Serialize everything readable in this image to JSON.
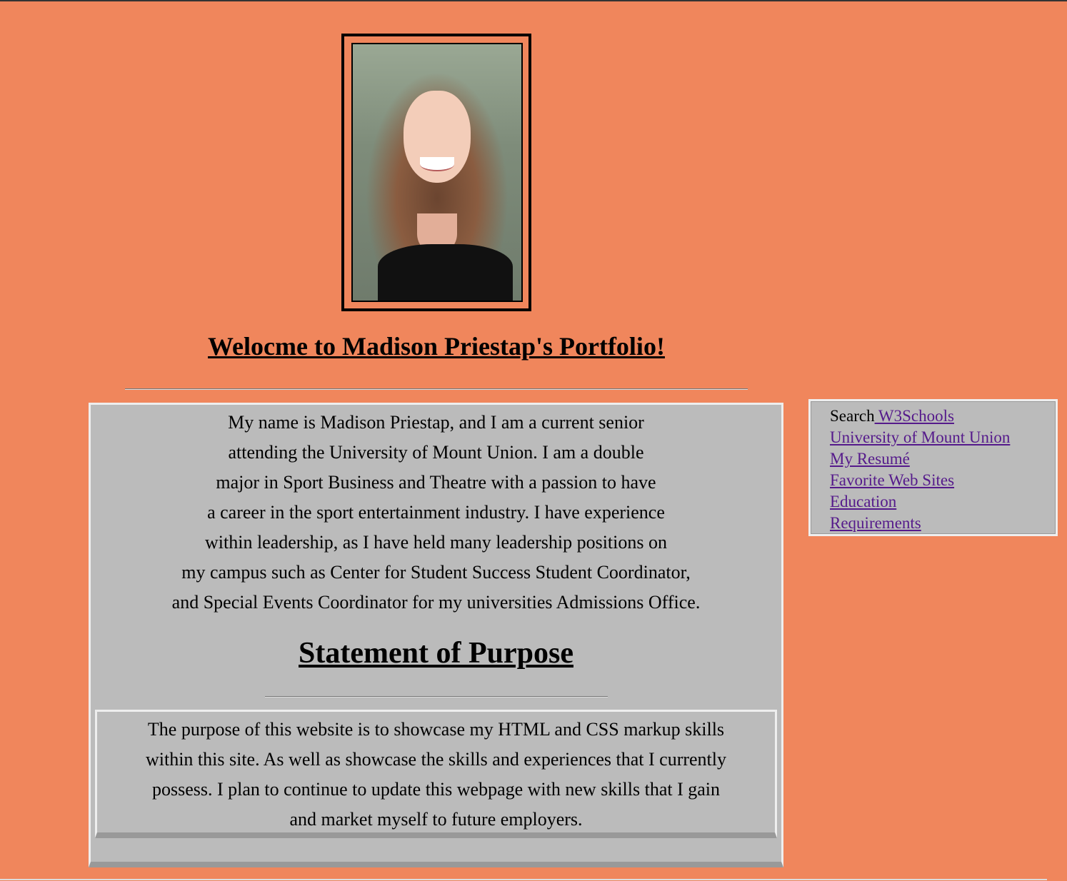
{
  "header": {
    "welcome_title": "Welocme to Madison Priestap's Portfolio!"
  },
  "profile_photo": {
    "alt": "Portrait of Madison Priestap"
  },
  "intro": {
    "lines": [
      "My name is Madison Priestap, and I am a current senior",
      "attending the University of Mount Union. I am a double",
      "major in Sport Business and Theatre with a passion to have",
      "a career in the sport entertainment industry. I have experience",
      "within leadership, as I have held many leadership positions on",
      "my campus such as Center for Student Success Student Coordinator,",
      "and Special Events Coordinator for my universities Admissions Office."
    ]
  },
  "purpose": {
    "title": "Statement of Purpose",
    "lines": [
      "The purpose of this website is to showcase my HTML and CSS markup skills",
      "within this site. As well as showcase the skills and experiences that I currently",
      "possess. I plan to continue to update this webpage with new skills that I gain",
      "and market myself to future employers."
    ]
  },
  "sidebar": {
    "search_label": "Search",
    "links": [
      " W3Schools",
      "University of Mount Union",
      "My Resumé",
      "Favorite Web Sites",
      "Education",
      "Requirements"
    ]
  },
  "colors": {
    "background": "#f0865c",
    "panel": "#bbbbbb",
    "link": "#551a8b"
  }
}
